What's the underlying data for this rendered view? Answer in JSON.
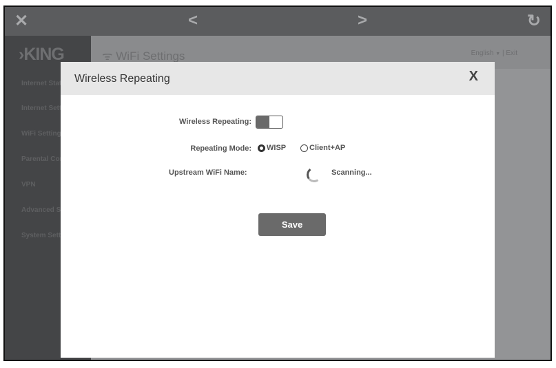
{
  "topbar": {
    "close": "✕",
    "back": "<",
    "forward": ">",
    "refresh": "↻"
  },
  "sidebar": {
    "logo": "›KING",
    "items": [
      {
        "label": "Internet Status"
      },
      {
        "label": "Internet Settings"
      },
      {
        "label": "WiFi Settings"
      },
      {
        "label": "Parental Controls"
      },
      {
        "label": "VPN"
      },
      {
        "label": "Advanced Settings"
      },
      {
        "label": "System Settings"
      }
    ]
  },
  "header": {
    "wifi_icon": "ᯤ",
    "title": "WiFi Settings",
    "language": "English",
    "lang_arrow": "▼",
    "separator": "|",
    "exit": "Exit"
  },
  "modal": {
    "title": "Wireless Repeating",
    "close": "X",
    "wireless_repeating_label": "Wireless Repeating:",
    "wireless_repeating_on": true,
    "mode_label": "Repeating Mode:",
    "modes": [
      "WISP",
      "Client+AP"
    ],
    "selected_mode": "WISP",
    "upstream_label": "Upstream WiFi Name:",
    "scanning": "Scanning...",
    "save": "Save"
  }
}
